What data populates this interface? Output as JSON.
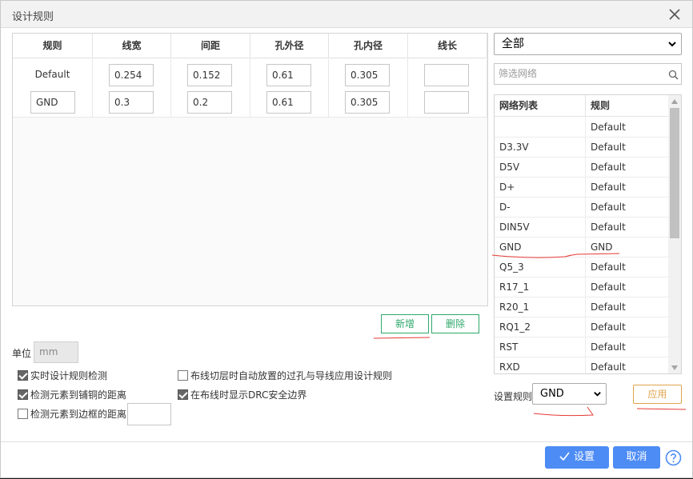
{
  "dialog": {
    "title": "设计规则"
  },
  "rules_table": {
    "columns": [
      "规则",
      "线宽",
      "间距",
      "孔外径",
      "孔内径",
      "线长"
    ],
    "rows": [
      {
        "name": "Default",
        "width": "0.254",
        "clearance": "0.152",
        "via_outer": "0.61",
        "via_inner": "0.305",
        "length": ""
      },
      {
        "name": "GND",
        "width": "0.3",
        "clearance": "0.2",
        "via_outer": "0.61",
        "via_inner": "0.305",
        "length": ""
      }
    ]
  },
  "buttons": {
    "add": "新增",
    "delete": "删除",
    "apply": "应用",
    "ok": "设置",
    "cancel": "取消"
  },
  "unit": {
    "label": "单位",
    "value": "mm"
  },
  "options": {
    "realtime_drc": "实时设计规则检测",
    "check_copper": "检测元素到铺铜的距离",
    "check_border": "检测元素到边框的距离",
    "auto_via": "布线切层时自动放置的过孔与导线应用设计规则",
    "show_drc_boundary": "在布线时显示DRC安全边界",
    "states": {
      "realtime_drc": true,
      "check_copper": true,
      "check_border": false,
      "auto_via": false,
      "show_drc_boundary": true
    }
  },
  "net_filter": {
    "selected": "全部",
    "search_placeholder": "筛选网络"
  },
  "net_table": {
    "columns": [
      "网络列表",
      "规则"
    ],
    "rows": [
      {
        "net": "",
        "rule": "Default"
      },
      {
        "net": "D3.3V",
        "rule": "Default"
      },
      {
        "net": "D5V",
        "rule": "Default"
      },
      {
        "net": "D+",
        "rule": "Default"
      },
      {
        "net": "D-",
        "rule": "Default"
      },
      {
        "net": "DIN5V",
        "rule": "Default"
      },
      {
        "net": "GND",
        "rule": "GND"
      },
      {
        "net": "Q5_3",
        "rule": "Default"
      },
      {
        "net": "R17_1",
        "rule": "Default"
      },
      {
        "net": "R20_1",
        "rule": "Default"
      },
      {
        "net": "RQ1_2",
        "rule": "Default"
      },
      {
        "net": "RST",
        "rule": "Default"
      },
      {
        "net": "RXD",
        "rule": "Default"
      }
    ]
  },
  "set_rule": {
    "label": "设置规则",
    "selected": "GND"
  },
  "colors": {
    "accent_green": "#2ea86b",
    "accent_orange": "#e0a44d",
    "primary_blue": "#4d8cf5",
    "annotation_red": "#e53935"
  }
}
